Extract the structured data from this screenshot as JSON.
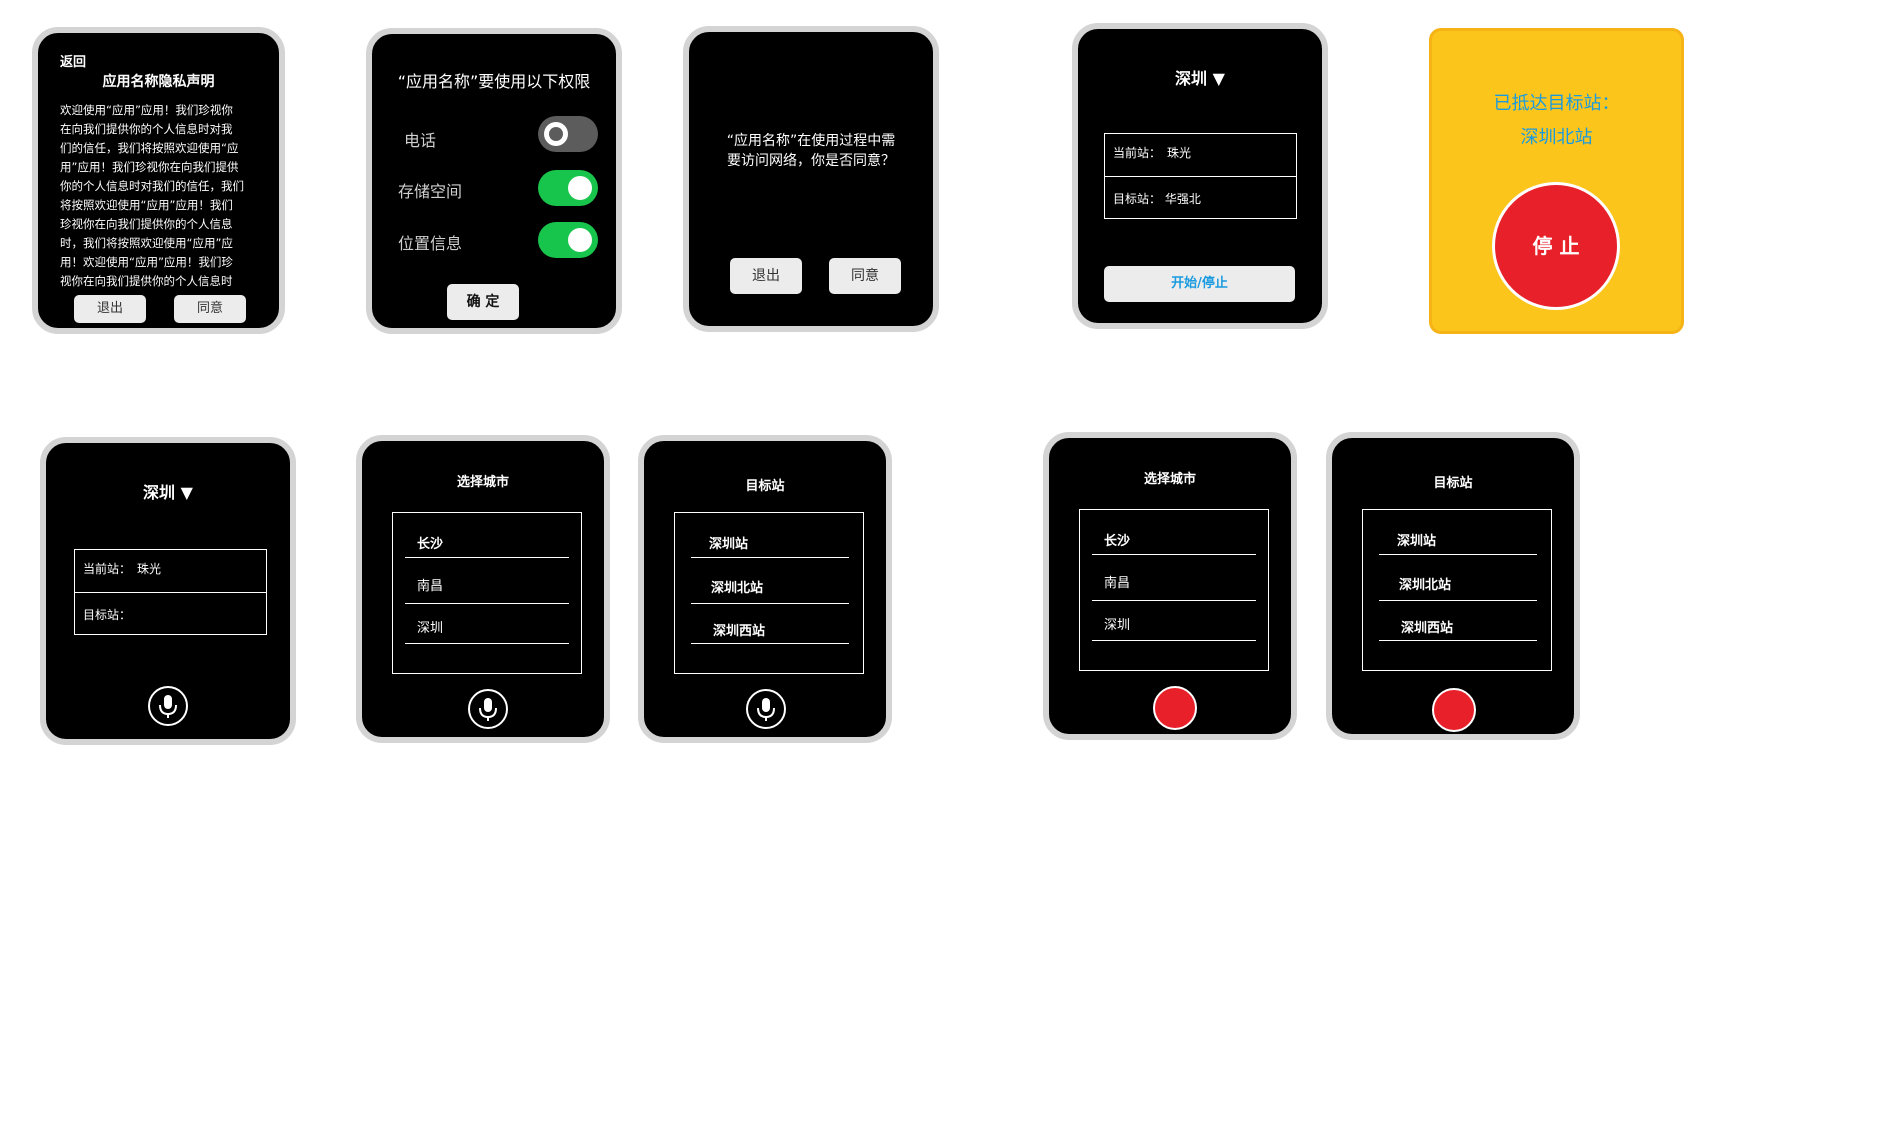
{
  "w1": {
    "back": "返回",
    "title": "应用名称隐私声明",
    "body_lines": [
      "欢迎使用“应用”应用！我们珍视你",
      "在向我们提供你的个人信息时对我",
      "们的信任，我们将按照欢迎使用“应",
      "用”应用！我们珍视你在向我们提供",
      "你的个人信息时对我们的信任，我们",
      "将按照欢迎使用“应用”应用！我们",
      "珍视你在向我们提供你的个人信息",
      "时，我们将按照欢迎使用“应用”应",
      "用！欢迎使用“应用”应用！我们珍",
      "视你在向我们提供你的个人信息时"
    ],
    "exit": "退出",
    "agree": "同意"
  },
  "w2": {
    "title": "“应用名称”要使用以下权限",
    "perms": [
      {
        "label": "电话",
        "state": "off"
      },
      {
        "label": "存储空间",
        "state": "on"
      },
      {
        "label": "位置信息",
        "state": "on"
      }
    ],
    "ok": "确 定"
  },
  "w3": {
    "line1": "“应用名称”在使用过程中需",
    "line2": "要访问网络，你是否同意？",
    "exit": "退出",
    "agree": "同意"
  },
  "w4": {
    "city": "深圳 ▼",
    "current": "当前站：　珠光",
    "target": "目标站：  华强北",
    "button": "开始/停止"
  },
  "w5": {
    "line1": "已抵达目标站：",
    "line2": "深圳北站",
    "stop": "停 止"
  },
  "w6": {
    "city": "深圳 ▼",
    "current": "当前站：　珠光",
    "target": "目标站："
  },
  "city_select": {
    "title": "选择城市",
    "items": [
      "长沙",
      "南昌",
      "深圳"
    ]
  },
  "target_select": {
    "title": "目标站",
    "items": [
      "深圳站",
      "深圳北站",
      "深圳西站"
    ]
  },
  "colors": {
    "toggle_on": "#17c44c",
    "accent_blue": "#1a9be0",
    "stop_red": "#e8202a",
    "yellow_bg": "#fbc51c"
  }
}
